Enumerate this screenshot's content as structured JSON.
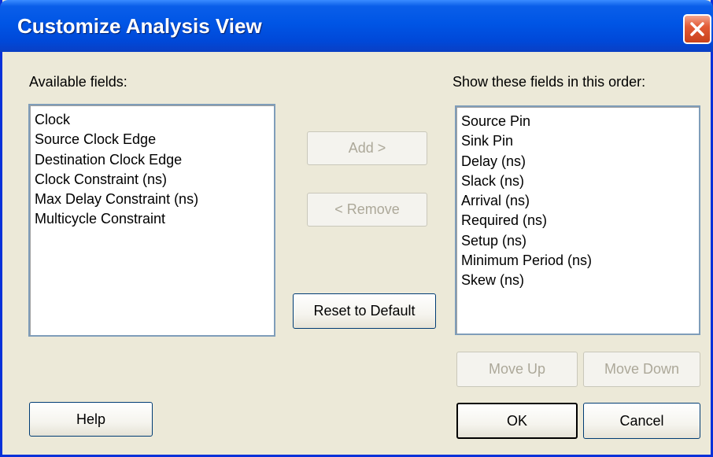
{
  "window": {
    "title": "Customize Analysis View"
  },
  "available": {
    "label": "Available fields:",
    "items": [
      "Clock",
      "Source Clock Edge",
      "Destination Clock Edge",
      "Clock Constraint (ns)",
      "Max Delay Constraint (ns)",
      "Multicycle Constraint"
    ]
  },
  "shown": {
    "label": "Show these fields in this order:",
    "items": [
      "Source Pin",
      "Sink Pin",
      "Delay (ns)",
      "Slack (ns)",
      "Arrival (ns)",
      "Required (ns)",
      "Setup (ns)",
      "Minimum Period (ns)",
      "Skew (ns)"
    ]
  },
  "buttons": {
    "add": "Add >",
    "remove": "< Remove",
    "reset": "Reset to Default",
    "move_up": "Move Up",
    "move_down": "Move Down",
    "help": "Help",
    "ok": "OK",
    "cancel": "Cancel"
  },
  "icons": {
    "close": "close-icon"
  },
  "colors": {
    "titlebar": "#0055e5",
    "dialog_bg": "#ece9d8",
    "close_button": "#e35b36",
    "disabled_text": "#aca899"
  }
}
